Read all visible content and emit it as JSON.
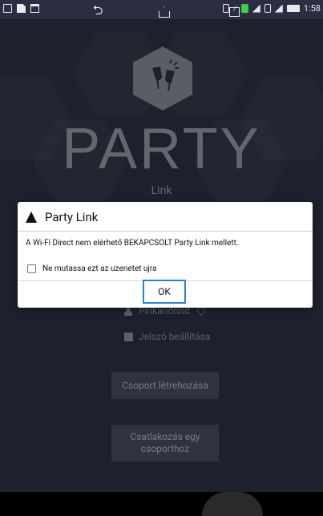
{
  "status_bar": {
    "time": "1:58"
  },
  "app": {
    "logo_title": "PARTY",
    "logo_subtitle": "Link"
  },
  "background": {
    "username": "Pinkandroid",
    "password_option_label": "Jelszó beállítása",
    "create_group_button": "Csoport létrehozása",
    "join_group_button_line1": "Csatlakozás egy",
    "join_group_button_line2": "csoporthoz"
  },
  "dialog": {
    "title": "Party Link",
    "message": "A Wi-Fi Direct nem elérhető BEKAPCSOLT Party Link mellett.",
    "checkbox_label": "Ne mutassa ezt az uzenetet ujra",
    "ok_button": "OK"
  },
  "colors": {
    "accent": "#2a7fd6",
    "background": "#2f3246"
  }
}
